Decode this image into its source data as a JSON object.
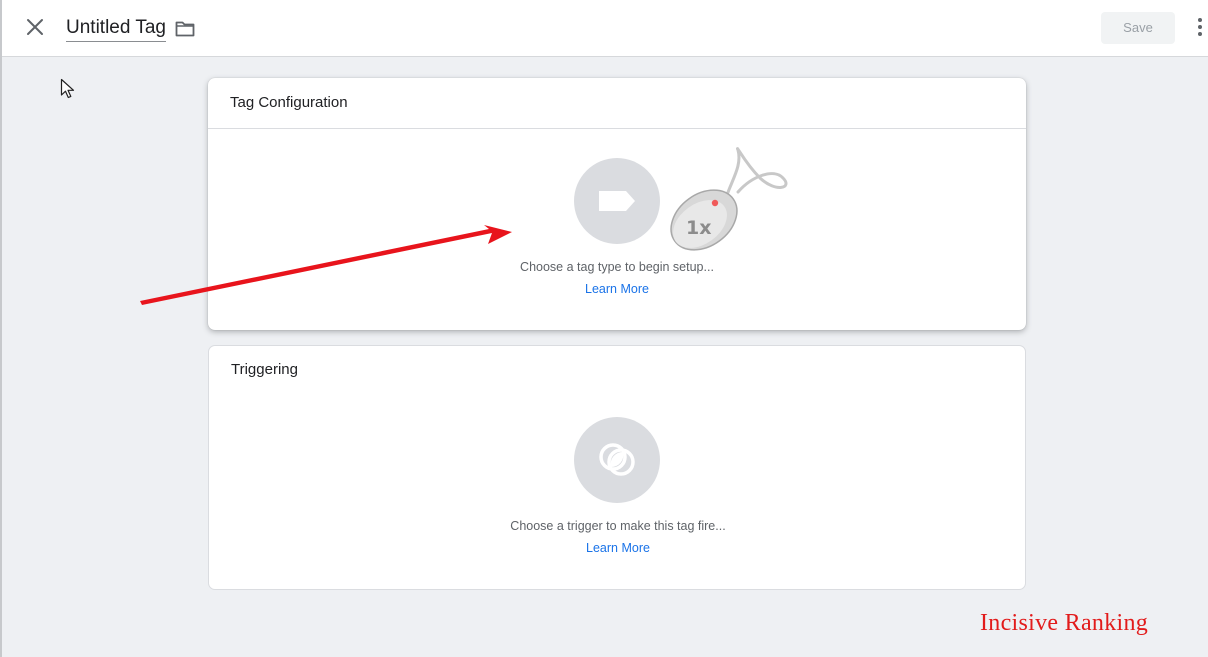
{
  "header": {
    "title": "Untitled Tag",
    "save_label": "Save"
  },
  "tag_card": {
    "title": "Tag Configuration",
    "hint": "Choose a tag type to begin setup...",
    "link": "Learn More"
  },
  "trigger_card": {
    "title": "Triggering",
    "hint": "Choose a trigger to make this tag fire...",
    "link": "Learn More"
  },
  "annotations": {
    "click_badge": "1x"
  },
  "watermark": "Incisive Ranking",
  "colors": {
    "accent_link": "#1a73e8",
    "arrow": "#e8141c",
    "watermark": "#e21b1b"
  },
  "icons": [
    "close-icon",
    "folder-icon",
    "more-vert-icon",
    "tag-icon",
    "trigger-icon",
    "mouse-click-icon",
    "pointer-cursor-icon"
  ]
}
